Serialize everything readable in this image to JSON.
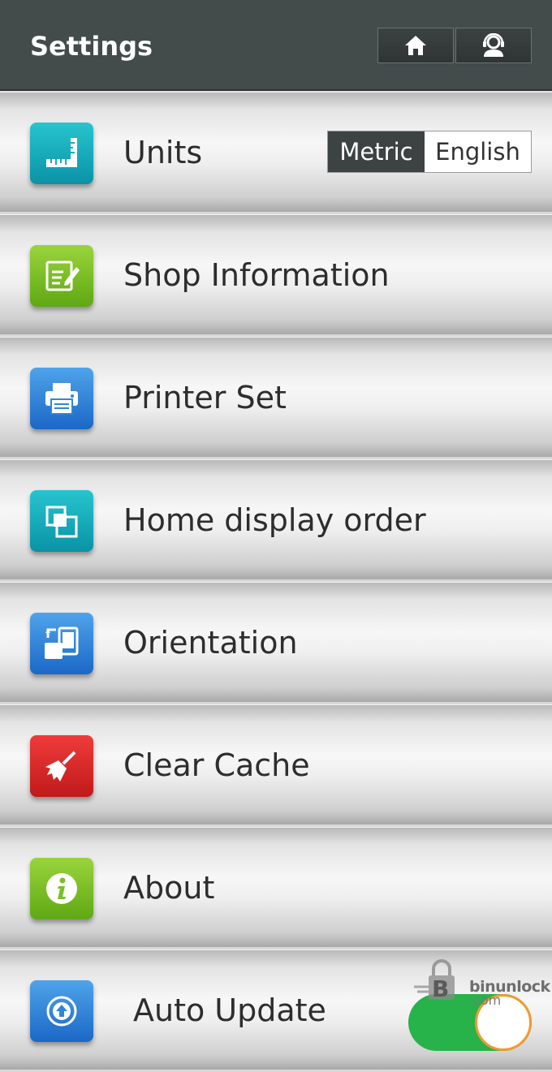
{
  "header": {
    "title": "Settings",
    "buttons": [
      {
        "icon": "home-icon"
      },
      {
        "icon": "support-agent-icon"
      }
    ]
  },
  "settings": {
    "items": [
      {
        "label": "Units",
        "icon": "ruler-icon",
        "color": "#19abbb"
      },
      {
        "label": "Shop Information",
        "icon": "edit-document-icon",
        "color": "#79bf27"
      },
      {
        "label": "Printer Set",
        "icon": "printer-icon",
        "color": "#2f86da"
      },
      {
        "label": "Home display order",
        "icon": "layers-icon",
        "color": "#19abbb"
      },
      {
        "label": "Orientation",
        "icon": "rotate-device-icon",
        "color": "#2f86da"
      },
      {
        "label": "Clear Cache",
        "icon": "broom-icon",
        "color": "#d92626"
      },
      {
        "label": "About",
        "icon": "info-icon",
        "color": "#79bf27"
      },
      {
        "label": "Auto Update",
        "icon": "update-arrow-icon",
        "color": "#2f86da"
      }
    ]
  },
  "units": {
    "options": [
      "Metric",
      "English"
    ],
    "selected": "Metric"
  },
  "auto_update": {
    "enabled": true,
    "toggle_color": "#27b24a"
  },
  "watermark": {
    "line1": "binunlock",
    "line2": ".com"
  },
  "colors": {
    "header_bg": "#434b4b",
    "selected_segment": "#3d4242"
  }
}
